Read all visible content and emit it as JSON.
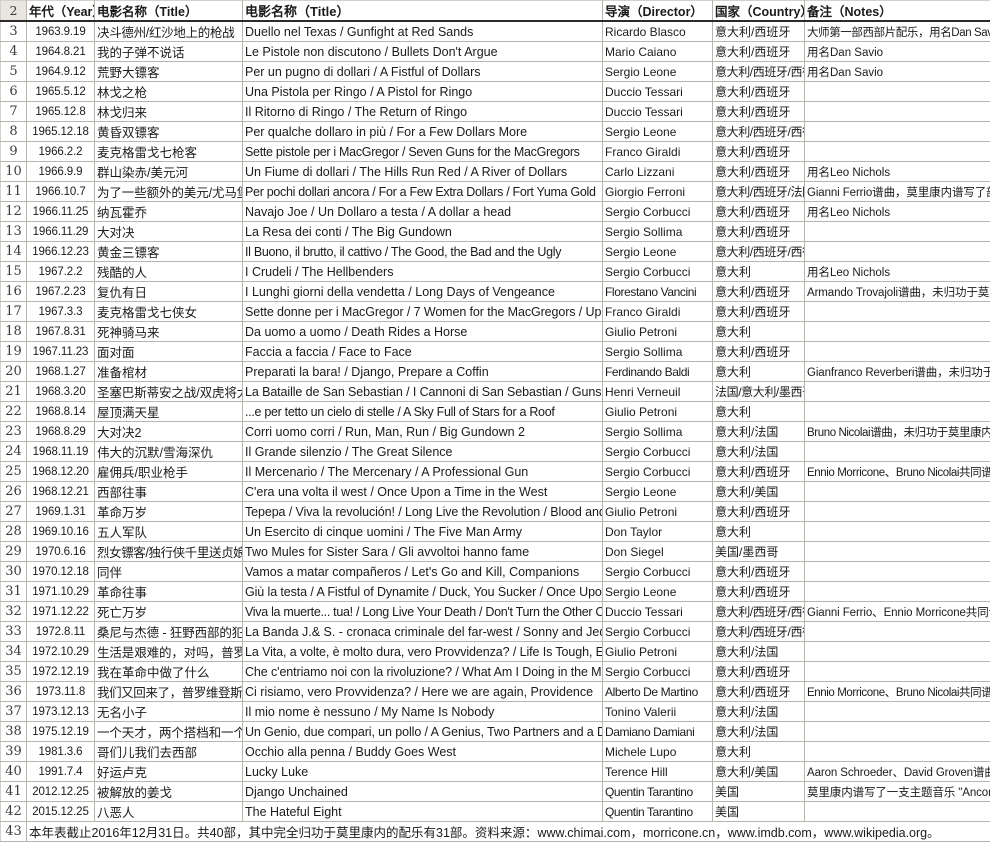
{
  "sheet": {
    "row_start_number": 2,
    "headers": {
      "row_label": "2",
      "year": "年代（Year）",
      "title_cn": "电影名称（Title）",
      "title_orig": "电影名称（Title）",
      "director": "导演（Director）",
      "country": "国家（Country）",
      "notes": "备注（Notes）"
    },
    "footer": {
      "row_label": "43",
      "text": "本年表截止2016年12月31日。共40部，其中完全归功于莫里康内的配乐有31部。资料来源：www.chimai.com，morricone.cn，www.imdb.com，www.wikipedia.org。"
    },
    "colors": {
      "highlight": "#9fcdf0",
      "row_header_bg": "#e8e6de",
      "grid_line": "#b9b5ad",
      "header_rule": "#2b2b2b"
    },
    "rows": [
      {
        "n": "3",
        "year": "1963.9.19",
        "title_cn": "决斗德州/红沙地上的枪战",
        "title_orig": "Duello nel Texas / Gunfight at Red Sands",
        "director": "Ricardo Blasco",
        "country": "意大利/西班牙",
        "notes": "大师第一部西部片配乐，用名Dan Savio",
        "hl": false,
        "cn_size": "squeeze",
        "notes_size": "squeeze2"
      },
      {
        "n": "4",
        "year": "1964.8.21",
        "title_cn": "我的子弹不说话",
        "title_orig": "Le Pistole non discutono / Bullets Don't Argue",
        "director": "Mario Caiano",
        "country": "意大利/西班牙",
        "notes": "用名Dan Savio",
        "hl": false,
        "cn_size": "",
        "notes_size": ""
      },
      {
        "n": "5",
        "year": "1964.9.12",
        "title_cn": "荒野大镖客",
        "title_orig": "Per un pugno di dollari / A Fistful of Dollars",
        "director": "Sergio Leone",
        "country": "意大利/西班牙/西德",
        "notes": "用名Dan Savio",
        "hl": false,
        "cn_size": "",
        "notes_size": "",
        "country_size": "squeeze2"
      },
      {
        "n": "6",
        "year": "1965.5.12",
        "title_cn": "林戈之枪",
        "title_orig": "Una Pistola per Ringo / A Pistol for Ringo",
        "director": "Duccio Tessari",
        "country": "意大利/西班牙",
        "notes": "",
        "hl": false
      },
      {
        "n": "7",
        "year": "1965.12.8",
        "title_cn": "林戈归来",
        "title_orig": "Il Ritorno di Ringo / The Return of Ringo",
        "director": "Duccio Tessari",
        "country": "意大利/西班牙",
        "notes": "",
        "hl": false
      },
      {
        "n": "8",
        "year": "1965.12.18",
        "title_cn": "黄昏双镖客",
        "title_orig": "Per qualche dollaro in più / For a Few Dollars More",
        "director": "Sergio Leone",
        "country": "意大利/西班牙/西德",
        "notes": "",
        "hl": false,
        "country_size": "squeeze2"
      },
      {
        "n": "9",
        "year": "1966.2.2",
        "title_cn": "麦克格雷戈七枪客",
        "title_orig": "Sette pistole per i MacGregor / Seven Guns for the MacGregors",
        "director": "Franco Giraldi",
        "country": "意大利/西班牙",
        "notes": "",
        "hl": false,
        "orig_size": "squeeze"
      },
      {
        "n": "10",
        "year": "1966.9.9",
        "title_cn": "群山染赤/美元河",
        "title_orig": "Un Fiume di dollari / The Hills Run Red / A River of Dollars",
        "director": "Carlo Lizzani",
        "country": "意大利/西班牙",
        "notes": "用名Leo Nichols",
        "hl": false
      },
      {
        "n": "11",
        "year": "1966.10.7",
        "title_cn": "为了一些额外的美元/尤马堡金币",
        "title_orig": "Per pochi dollari ancora / For a Few Extra Dollars / Fort Yuma Gold",
        "director": "Giorgio Ferroni",
        "country": "意大利/西班牙/法国",
        "notes": "Gianni Ferrio谱曲，莫里康内谱写了部分主题音乐",
        "hl": true,
        "cn_size": "tiny2",
        "orig_size": "squeeze",
        "country_size": "squeeze2",
        "notes_size": "tiny"
      },
      {
        "n": "12",
        "year": "1966.11.25",
        "title_cn": "纳瓦霍乔",
        "title_orig": "Navajo Joe / Un Dollaro a testa / A dollar a head",
        "director": "Sergio Corbucci",
        "country": "意大利/西班牙",
        "notes": "用名Leo Nichols",
        "hl": false
      },
      {
        "n": "13",
        "year": "1966.11.29",
        "title_cn": "大对决",
        "title_orig": "La Resa dei conti / The Big Gundown",
        "director": "Sergio Sollima",
        "country": "意大利/西班牙",
        "notes": "",
        "hl": false
      },
      {
        "n": "14",
        "year": "1966.12.23",
        "title_cn": "黄金三镖客",
        "title_orig": "Il Buono, il brutto, il cattivo / The Good, the Bad and the Ugly",
        "director": "Sergio Leone",
        "country": "意大利/西班牙/西德",
        "notes": "",
        "hl": false,
        "orig_size": "squeeze",
        "country_size": "squeeze2"
      },
      {
        "n": "15",
        "year": "1967.2.2",
        "title_cn": "残酷的人",
        "title_orig": "I Crudeli / The Hellbenders",
        "director": "Sergio Corbucci",
        "country": "意大利",
        "notes": "用名Leo Nichols",
        "hl": false
      },
      {
        "n": "16",
        "year": "1967.2.23",
        "title_cn": "复仇有日",
        "title_orig": "I Lunghi giorni della vendetta / Long Days of Vengeance",
        "director": "Florestano Vancini",
        "country": "意大利/西班牙",
        "notes": "Armando Trovajoli谱曲，未归功于莫里康内",
        "hl": true,
        "dir_size": "squeeze2",
        "notes_size": "tiny"
      },
      {
        "n": "17",
        "year": "1967.3.3",
        "title_cn": "麦克格雷戈七侠女",
        "title_orig": "Sette donne per i MacGregor / 7 Women for the MacGregors / Up the MacGregors!",
        "director": "Franco Giraldi",
        "country": "意大利/西班牙",
        "notes": "",
        "hl": false,
        "orig_size": "tiny2"
      },
      {
        "n": "18",
        "year": "1967.8.31",
        "title_cn": "死神骑马来",
        "title_orig": "Da uomo a uomo / Death Rides a Horse",
        "director": "Giulio Petroni",
        "country": "意大利",
        "notes": "",
        "hl": false
      },
      {
        "n": "19",
        "year": "1967.11.23",
        "title_cn": "面对面",
        "title_orig": "Faccia a faccia / Face to Face",
        "director": "Sergio Sollima",
        "country": "意大利/西班牙",
        "notes": "",
        "hl": false
      },
      {
        "n": "20",
        "year": "1968.1.27",
        "title_cn": "准备棺材",
        "title_orig": "Preparati la bara! / Django, Prepare a Coffin",
        "director": "Ferdinando Baldi",
        "country": "意大利",
        "notes": "Gianfranco Reverberi谱曲，未归功于莫里康内",
        "hl": true,
        "dir_size": "squeeze2",
        "notes_size": "tiny"
      },
      {
        "n": "21",
        "year": "1968.3.20",
        "title_cn": "圣塞巴斯蒂安之战/双虎将大追踪",
        "title_orig": "La Bataille de San Sebastian / I Cannoni di San Sebastian / Guns for San Sebastian",
        "director": "Henri Verneuil",
        "country": "法国/意大利/墨西哥",
        "notes": "",
        "hl": false,
        "cn_size": "tiny2",
        "orig_size": "tiny2",
        "country_size": "squeeze2"
      },
      {
        "n": "22",
        "year": "1968.8.14",
        "title_cn": "屋顶满天星",
        "title_orig": "...e per tetto un cielo di stelle / A Sky Full of Stars for a Roof",
        "director": "Giulio Petroni",
        "country": "意大利",
        "notes": "",
        "hl": false,
        "orig_size": "squeeze"
      },
      {
        "n": "23",
        "year": "1968.8.29",
        "title_cn": "大对决2",
        "title_orig": "Corri uomo corri / Run, Man, Run / Big Gundown 2",
        "director": "Sergio Sollima",
        "country": "意大利/法国",
        "notes": "Bruno Nicolai谱曲，未归功于莫里康内",
        "hl": true,
        "notes_size": "squeeze2"
      },
      {
        "n": "24",
        "year": "1968.11.19",
        "title_cn": "伟大的沉默/雪海深仇",
        "title_orig": "Il Grande silenzio / The Great Silence",
        "director": "Sergio Corbucci",
        "country": "意大利/法国",
        "notes": "",
        "hl": false
      },
      {
        "n": "25",
        "year": "1968.12.20",
        "title_cn": "雇佣兵/职业枪手",
        "title_orig": "Il Mercenario / The Mercenary / A Professional Gun",
        "director": "Sergio Corbucci",
        "country": "意大利/西班牙",
        "notes": "Ennio Morricone、Bruno Nicolai共同谱曲",
        "hl": true,
        "notes_size": "squeeze2"
      },
      {
        "n": "26",
        "year": "1968.12.21",
        "title_cn": "西部往事",
        "title_orig": "C'era una volta il west / Once Upon a Time in the West",
        "director": "Sergio Leone",
        "country": "意大利/美国",
        "notes": "",
        "hl": false
      },
      {
        "n": "27",
        "year": "1969.1.31",
        "title_cn": "革命万岁",
        "title_orig": "Tepepa / Viva la revolución! / Long Live the Revolution / Blood and Guns",
        "director": "Giulio Petroni",
        "country": "意大利/西班牙",
        "notes": "",
        "hl": false,
        "orig_size": "tiny2"
      },
      {
        "n": "28",
        "year": "1969.10.16",
        "title_cn": "五人军队",
        "title_orig": "Un Esercito di cinque uomini / The Five Man Army",
        "director": "Don Taylor",
        "country": "意大利",
        "notes": "",
        "hl": false
      },
      {
        "n": "29",
        "year": "1970.6.16",
        "title_cn": "烈女镖客/独行侠千里送贞娘",
        "title_orig": "Two Mules for Sister Sara / Gli avvoltoi hanno fame",
        "director": "Don Siegel",
        "country": "美国/墨西哥",
        "notes": "",
        "hl": false,
        "cn_size": "squeeze2"
      },
      {
        "n": "30",
        "year": "1970.12.18",
        "title_cn": "同伴",
        "title_orig": "Vamos a matar compañeros / Let's Go and Kill, Companions",
        "director": "Sergio Corbucci",
        "country": "意大利/西班牙",
        "notes": "",
        "hl": false
      },
      {
        "n": "31",
        "year": "1971.10.29",
        "title_cn": "革命往事",
        "title_orig": "Giù la testa / A Fistful of Dynamite / Duck, You Sucker / Once Upon a Time... the Revolution",
        "director": "Sergio Leone",
        "country": "意大利/西班牙",
        "notes": "",
        "hl": false,
        "orig_size": "tiny"
      },
      {
        "n": "32",
        "year": "1971.12.22",
        "title_cn": "死亡万岁",
        "title_orig": "Viva la muerte... tua! / Long Live Your Death / Don't Turn the Other Cheek",
        "director": "Duccio Tessari",
        "country": "意大利/西班牙/西德",
        "notes": "Gianni Ferrio、Ennio Morricone共同谱曲，比较有争议",
        "hl": true,
        "orig_size": "squeeze",
        "country_size": "squeeze2",
        "notes_size": "tiny"
      },
      {
        "n": "33",
        "year": "1972.8.11",
        "title_cn": "桑尼与杰德 - 狂野西部的犯罪记录",
        "title_orig": "La Banda J.& S. - cronaca criminale del far-west / Sonny and Jed",
        "director": "Sergio Corbucci",
        "country": "意大利/西班牙/西德",
        "notes": "",
        "hl": false,
        "cn_size": "tiny2",
        "country_size": "squeeze2"
      },
      {
        "n": "34",
        "year": "1972.10.29",
        "title_cn": "生活是艰难的，对吗，普罗维登斯",
        "title_orig": "La Vita, a volte, è molto dura, vero Provvidenza? / Life Is Tough, Eh Providence?",
        "director": "Giulio Petroni",
        "country": "意大利/法国",
        "notes": "",
        "hl": false,
        "cn_size": "tiny2",
        "orig_size": "tiny2"
      },
      {
        "n": "35",
        "year": "1972.12.19",
        "title_cn": "我在革命中做了什么",
        "title_orig": "Che c'entriamo noi con la rivoluzione? / What Am I Doing in the Middle of a Revolution?",
        "director": "Sergio Corbucci",
        "country": "意大利/西班牙",
        "notes": "",
        "hl": false,
        "orig_size": "tiny"
      },
      {
        "n": "36",
        "year": "1973.11.8",
        "title_cn": "我们又回来了，普罗维登斯",
        "title_orig": "Ci risiamo, vero Provvidenza? / Here we are again, Providence",
        "director": "Alberto De Martino",
        "country": "意大利/西班牙",
        "notes": "Ennio Morricone、Bruno Nicolai共同谱曲",
        "hl": true,
        "cn_size": "squeeze2",
        "dir_size": "squeeze2",
        "notes_size": "squeeze2"
      },
      {
        "n": "37",
        "year": "1973.12.13",
        "title_cn": "无名小子",
        "title_orig": "Il mio nome è nessuno / My Name Is Nobody",
        "director": "Tonino Valerii",
        "country": "意大利/法国",
        "notes": "",
        "hl": false
      },
      {
        "n": "38",
        "year": "1975.12.19",
        "title_cn": "一个天才，两个搭档和一个傻子",
        "title_orig": "Un Genio, due compari, un pollo / A Genius, Two Partners and a Dupe",
        "director": "Damiano Damiani",
        "country": "意大利/法国",
        "notes": "",
        "hl": false,
        "cn_size": "tiny2",
        "orig_size": "tiny2",
        "dir_size": "squeeze2"
      },
      {
        "n": "39",
        "year": "1981.3.6",
        "title_cn": "哥们儿我们去西部",
        "title_orig": "Occhio alla penna / Buddy Goes West",
        "director": "Michele Lupo",
        "country": "意大利",
        "notes": "",
        "hl": false
      },
      {
        "n": "40",
        "year": "1991.7.4",
        "title_cn": "好运卢克",
        "title_orig": "Lucky Luke",
        "director": "Terence Hill",
        "country": "意大利/美国",
        "notes": "Aaron Schroeder、David Groven谱曲，未归功于莫里康内",
        "hl": true,
        "notes_size": "tiny"
      },
      {
        "n": "41",
        "year": "2012.12.25",
        "title_cn": "被解放的姜戈",
        "title_orig": "Django Unchained",
        "director": "Quentin Tarantino",
        "country": "美国",
        "notes": "莫里康内谱写了一支主题音乐 \"Ancora qui\"",
        "hl": true,
        "dir_size": "squeeze2",
        "notes_size": "tiny"
      },
      {
        "n": "42",
        "year": "2015.12.25",
        "title_cn": "八恶人",
        "title_orig": "The Hateful Eight",
        "director": "Quentin Tarantino",
        "country": "美国",
        "notes": "",
        "hl": false,
        "dir_size": "squeeze2"
      }
    ]
  }
}
